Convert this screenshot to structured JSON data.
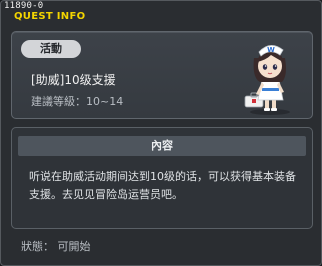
{
  "window": {
    "quest_id": "11890-0",
    "title": "QUEST INFO"
  },
  "summary": {
    "category": "活動",
    "quest_name": "[助威]10级支援",
    "level_requirement": "建議等級：10~14",
    "npc_icon": "npc-nurse-character-icon"
  },
  "details": {
    "header": "內容",
    "description": "听说在助威活动期间达到10级的话，可以获得基本装备支援。去见见冒险岛运营员吧。"
  },
  "status": "狀態： 可開始"
}
